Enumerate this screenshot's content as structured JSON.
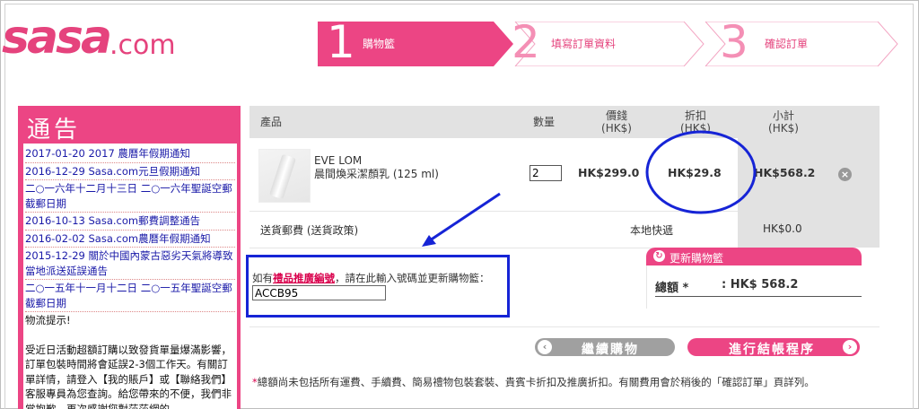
{
  "brand": {
    "logo_main": "sasa",
    "logo_suffix": ".com"
  },
  "steps": [
    {
      "number": "1",
      "label": "購物籃"
    },
    {
      "number": "2",
      "label": "填寫訂單資料"
    },
    {
      "number": "3",
      "label": "確認訂單"
    }
  ],
  "notice": {
    "title": "通告",
    "items": [
      {
        "text": "2017-01-20 2017 農曆年假期通知"
      },
      {
        "text": "2016-12-29 Sasa.com元旦假期通知"
      },
      {
        "text": "二○一六年十二月十三日 二○一六年聖誕空郵截郵日期"
      },
      {
        "text": "2016-10-13 Sasa.com郵費調整通告"
      },
      {
        "text": "2016-02-02 Sasa.com農曆年假期通知"
      },
      {
        "text": "2015-12-29 關於中國內蒙古惡劣天氣將導致當地派送延誤通告"
      },
      {
        "text": "二○一五年十一月十二日 二○一五年聖誕空郵截郵日期"
      }
    ],
    "logistics_title": "物流提示!",
    "logistics_body": "受近日活動超額訂購以致發貨單量爆滿影響，訂單包裝時間將會延誤2-3個工作天。有關訂單詳情，請登入【我的賬戶】或【聯絡我們】客服專員為您查詢。給您帶來的不便，我們非常抱歉，再次感謝您對莎莎網的"
  },
  "cart": {
    "headers": {
      "product": "產品",
      "quantity": "數量",
      "price": "價錢",
      "price_unit": "(HK$)",
      "discount": "折扣",
      "discount_unit": "(HK$)",
      "subtotal": "小計",
      "subtotal_unit": "(HK$)"
    },
    "item": {
      "brand": "EVE LOM",
      "name": "晨間煥采潔顏乳 (125 ml)",
      "quantity": "2",
      "price": "HK$299.0",
      "discount": "HK$29.8",
      "subtotal": "HK$568.2"
    },
    "shipping": {
      "label": "送貨郵費 (送貨政策)",
      "method": "本地快遞",
      "fee": "HK$0.0"
    },
    "update_label": "更新購物籃",
    "total_label": "總額 *",
    "total_value": ": HK$ 568.2"
  },
  "promo": {
    "prefix": "如有",
    "highlight": "禮品推廣編號",
    "suffix": "，請在此輸入號碼並更新購物籃：",
    "value": "ACCB95"
  },
  "buttons": {
    "continue_label": "繼續購物",
    "checkout_label": "進行結帳程序"
  },
  "footnote": {
    "star": "*",
    "text": "總額尚未包括所有運費、手續費、簡易禮物包裝套裝、貴賓卡折扣及推廣折扣。有關費用會於稍後的「確認訂單」頁詳列。"
  },
  "colors": {
    "brand_pink": "#ec4584",
    "annotation_blue": "#1624d6",
    "header_gray": "#e2e2e2"
  }
}
